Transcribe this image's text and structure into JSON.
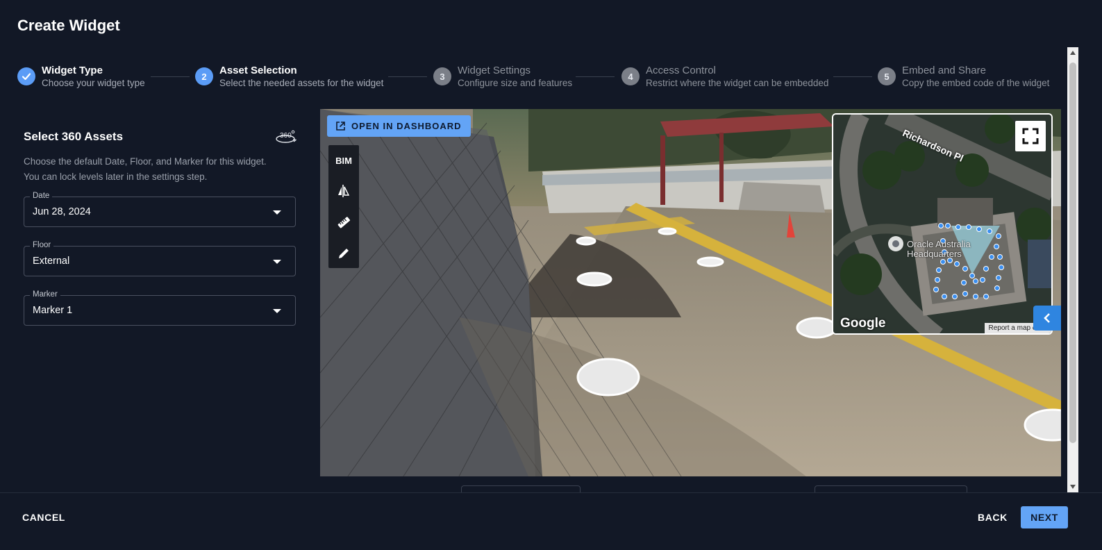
{
  "dialog": {
    "title": "Create Widget"
  },
  "stepper": {
    "steps": [
      {
        "number": "",
        "title": "Widget Type",
        "subtitle": "Choose your widget type",
        "state": "completed"
      },
      {
        "number": "2",
        "title": "Asset Selection",
        "subtitle": "Select the needed assets for the widget",
        "state": "active"
      },
      {
        "number": "3",
        "title": "Widget Settings",
        "subtitle": "Configure size and features",
        "state": "pending"
      },
      {
        "number": "4",
        "title": "Access Control",
        "subtitle": "Restrict where the widget can be embedded",
        "state": "pending"
      },
      {
        "number": "5",
        "title": "Embed and Share",
        "subtitle": "Copy the embed code of the widget",
        "state": "pending"
      }
    ]
  },
  "panel": {
    "title": "Select 360 Assets",
    "icon": "360-icon",
    "description_line1": "Choose the default Date, Floor, and Marker for this widget.",
    "description_line2": "You can lock levels later in the settings step.",
    "fields": [
      {
        "label": "Date",
        "value": "Jun 28, 2024"
      },
      {
        "label": "Floor",
        "value": "External"
      },
      {
        "label": "Marker",
        "value": "Marker 1"
      }
    ]
  },
  "viewer": {
    "open_dashboard_label": "OPEN IN DASHBOARD",
    "tools": [
      {
        "label": "BIM",
        "icon": "bim-text"
      },
      {
        "label": "",
        "icon": "compare-icon"
      },
      {
        "label": "",
        "icon": "ruler-icon"
      },
      {
        "label": "",
        "icon": "pencil-icon"
      }
    ],
    "minimap": {
      "street_label": "Richardson Pl",
      "place_label_line1": "Oracle Australia",
      "place_label_line2": "Headquarters",
      "provider": "Google",
      "report_link": "Report a map error"
    }
  },
  "footer": {
    "cancel_label": "CANCEL",
    "back_label": "BACK",
    "next_label": "NEXT"
  },
  "colors": {
    "background": "#121826",
    "accent": "#63a4f6",
    "step_active": "#5b9cf6",
    "step_pending": "#7b7f88"
  }
}
